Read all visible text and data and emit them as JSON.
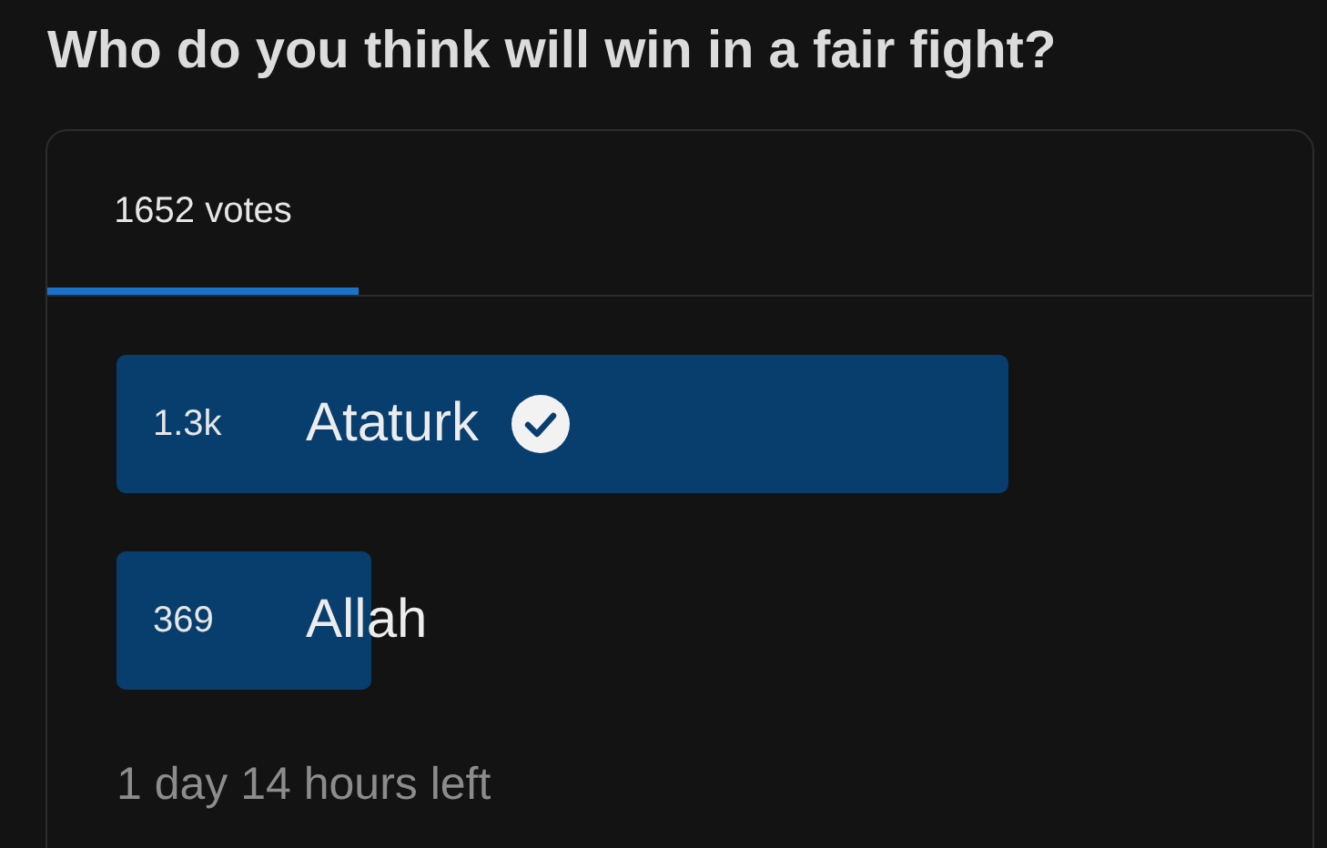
{
  "question": "Who do you think will win in a fair fight?",
  "tabs": [
    {
      "label": "1652 votes",
      "selected": true
    }
  ],
  "options": [
    {
      "count": "1.3k",
      "label": "Ataturk",
      "level": 0.79,
      "selected": true
    },
    {
      "count": "369",
      "label": "Allah",
      "level": 0.226,
      "selected": false
    }
  ],
  "time_left": "1 day 14 hours left"
}
